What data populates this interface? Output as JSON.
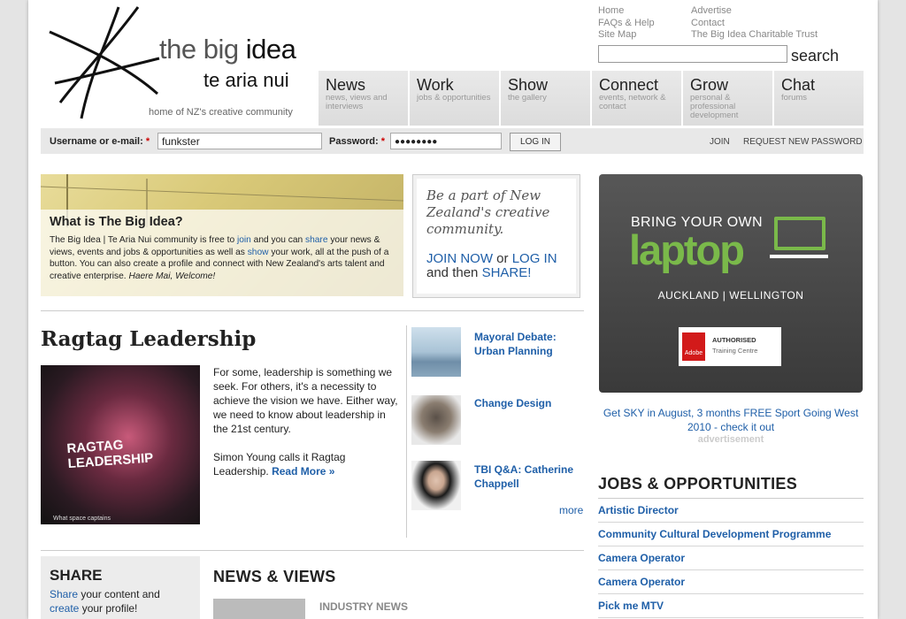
{
  "brand": {
    "title_pre": "the big",
    "title_bold": "idea",
    "subtitle": "te aria nui",
    "tagline": "home of NZ's creative community"
  },
  "top_links": {
    "col1": [
      "Home",
      "FAQs & Help",
      "Site Map"
    ],
    "col2": [
      "Advertise",
      "Contact",
      "The Big Idea Charitable Trust"
    ]
  },
  "search": {
    "button": "search",
    "value": ""
  },
  "nav": [
    {
      "title": "News",
      "sub": "news, views and interviews"
    },
    {
      "title": "Work",
      "sub": "jobs & opportunities"
    },
    {
      "title": "Show",
      "sub": "the gallery"
    },
    {
      "title": "Connect",
      "sub": "events, network & contact"
    },
    {
      "title": "Grow",
      "sub": "personal & professional development"
    },
    {
      "title": "Chat",
      "sub": "forums"
    }
  ],
  "login": {
    "username_label": "Username or e-mail:",
    "username_value": "funkster",
    "password_label": "Password:",
    "password_value": "●●●●●●●●",
    "button": "LOG IN",
    "join": "JOIN",
    "request": "REQUEST NEW PASSWORD",
    "required_mark": "*"
  },
  "hero": {
    "title": "What is The Big Idea?",
    "text_parts": [
      "The Big Idea | Te Aria Nui community is free to ",
      "join",
      " and you can ",
      "share",
      " your news & views, events and jobs & opportunities as well as ",
      "show",
      " your work, all at the push of a button. You can also create a profile and connect with New Zealand's arts talent and creative enterprise. ",
      "Haere Mai, Welcome!"
    ]
  },
  "join_box": {
    "italic": "Be a part of New Zealand's creative community.",
    "join": "JOIN NOW",
    "or": " or ",
    "login": "LOG IN",
    "then": "and then ",
    "share": "SHARE!"
  },
  "ad": {
    "line1": "BRING YOUR OWN",
    "line2": "laptop",
    "cities": "AUCKLAND  |  WELLINGTON",
    "badge_adobe": "Adobe",
    "badge_line1": "AUTHORISED",
    "badge_line2": "Training Centre",
    "link": "Get SKY in August, 3 months FREE Sport Going West 2010 - check it out",
    "label": "advertisement"
  },
  "feature": {
    "title": "Ragtag Leadership",
    "image_text": "RAGTAG LEADERSHIP",
    "image_caption": "What space captains",
    "para1": "For some, leadership is something we seek. For others, it's a necessity to achieve the vision we have. Either way, we need to know about leadership in the 21st century.",
    "para2": "Simon Young calls it Ragtag Leadership.",
    "read_more": "Read More »"
  },
  "side_articles": [
    {
      "title": "Mayoral Debate: Urban Planning"
    },
    {
      "title": "Change Design"
    },
    {
      "title": "TBI Q&A: Catherine Chappell"
    }
  ],
  "more": "more",
  "share": {
    "title": "SHARE",
    "share_link": "Share",
    "share_text": " your content and",
    "create_link": "create",
    "create_text": " your profile!"
  },
  "news_views": {
    "title": "NEWS & VIEWS",
    "category": "INDUSTRY NEWS"
  },
  "jobs": {
    "title": "JOBS & OPPORTUNITIES",
    "items": [
      "Artistic Director",
      "Community Cultural Development Programme",
      "Camera Operator",
      "Camera Operator",
      "Pick me MTV"
    ]
  }
}
